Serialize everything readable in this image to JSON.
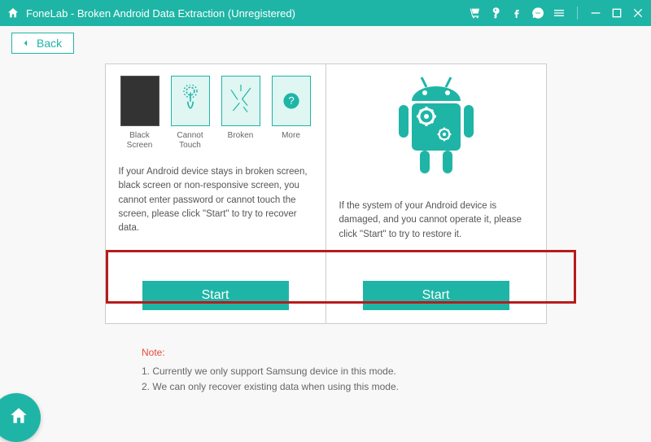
{
  "titlebar": {
    "title": "FoneLab - Broken Android Data Extraction (Unregistered)"
  },
  "back": {
    "label": "Back"
  },
  "left_panel": {
    "tiles": [
      {
        "label": "Black Screen"
      },
      {
        "label": "Cannot Touch"
      },
      {
        "label": "Broken"
      },
      {
        "label": "More"
      }
    ],
    "description": "If your Android device stays in broken screen, black screen or non-responsive screen, you cannot enter password or cannot touch the screen, please click \"Start\" to try to recover data.",
    "start": "Start"
  },
  "right_panel": {
    "description": "If the system of your Android device is damaged, and you cannot operate it, please click \"Start\" to try to restore it.",
    "start": "Start"
  },
  "note": {
    "title": "Note:",
    "line1": "1. Currently we only support Samsung device in this mode.",
    "line2": "2. We can only recover existing data when using this mode."
  }
}
